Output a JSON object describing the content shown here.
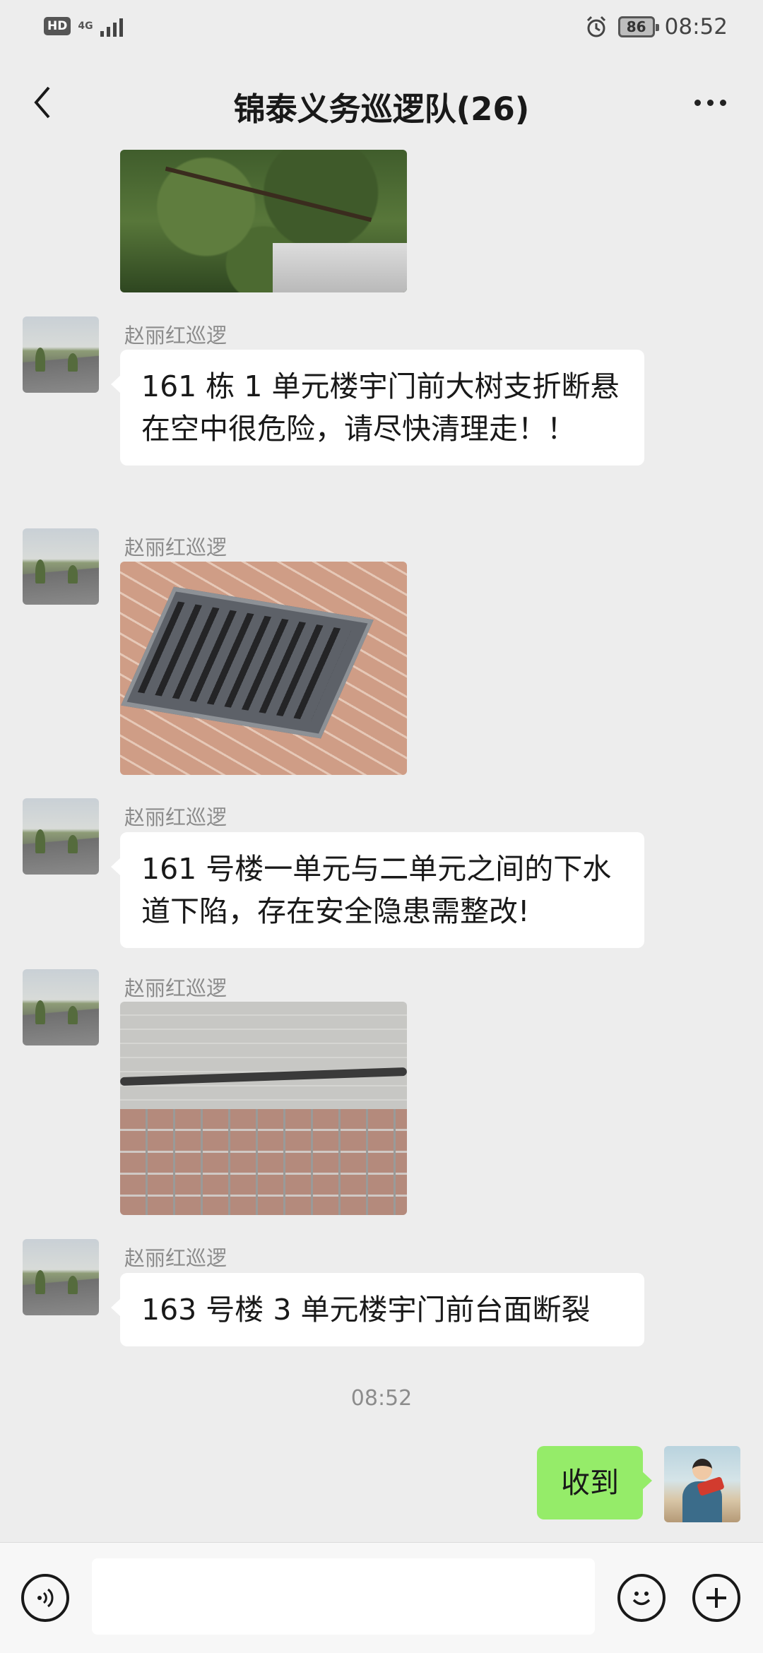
{
  "status_bar": {
    "hd": "HD",
    "network": "4G",
    "battery": "86",
    "time": "08:52"
  },
  "header": {
    "title": "锦泰义务巡逻队(26)",
    "back_icon": "chevron-left-icon",
    "more_icon": "more-dots-icon"
  },
  "messages": [
    {
      "type": "image",
      "from": "other",
      "image": "tree-branch-photo"
    },
    {
      "type": "text",
      "from": "other",
      "sender": "赵丽红巡逻",
      "text": "161 栋 1 单元楼宇门前大树支折断悬在空中很危险，请尽快清理走！！"
    },
    {
      "type": "image",
      "from": "other",
      "sender": "赵丽红巡逻",
      "image": "drain-grate-photo"
    },
    {
      "type": "text",
      "from": "other",
      "sender": "赵丽红巡逻",
      "text": "161 号楼一单元与二单元之间的下水道下陷，存在安全隐患需整改!"
    },
    {
      "type": "image",
      "from": "other",
      "sender": "赵丽红巡逻",
      "image": "cracked-step-photo"
    },
    {
      "type": "text",
      "from": "other",
      "sender": "赵丽红巡逻",
      "text": "163 号楼 3 单元楼宇门前台面断裂"
    },
    {
      "type": "time",
      "text": "08:52"
    },
    {
      "type": "text",
      "from": "me",
      "text": "收到"
    }
  ],
  "input_bar": {
    "voice_icon": "voice-icon",
    "emoji_icon": "emoji-icon",
    "plus_icon": "plus-icon",
    "value": ""
  },
  "colors": {
    "background": "#ededed",
    "bubble_other": "#ffffff",
    "bubble_me": "#95ec69"
  }
}
